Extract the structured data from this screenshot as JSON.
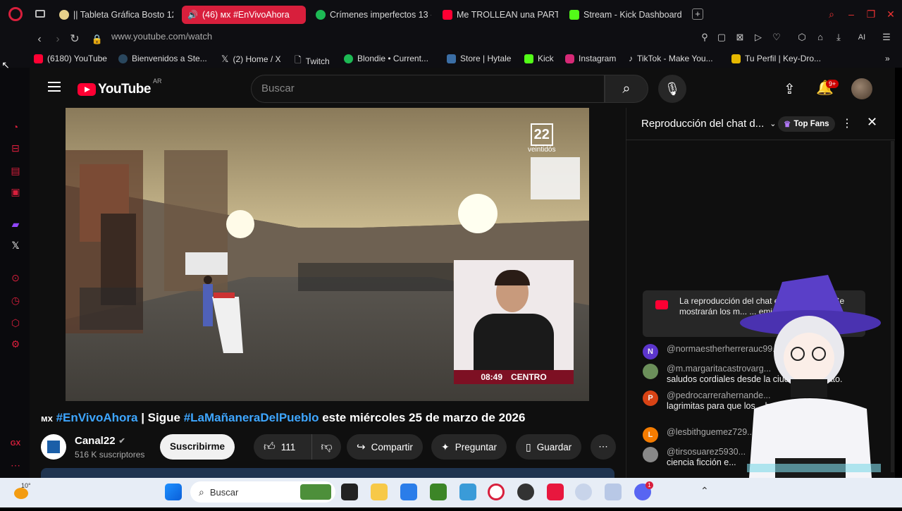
{
  "browser": {
    "tabs": [
      {
        "label": "|| Tableta Gráfica Bosto 12",
        "color": "#e6d08a"
      },
      {
        "label": "(46) мх #EnVivoAhora",
        "color": "#ffffff",
        "active": true
      },
      {
        "label": "Crímenes imperfectos 13 -",
        "color": "#1db954"
      },
      {
        "label": "Me TROLLEAN una PARTI",
        "color": "#ff0033"
      },
      {
        "label": "Stream - Kick Dashboard",
        "color": "#53fc18"
      }
    ],
    "url": "www.youtube.com/watch",
    "ai_label": "AI",
    "bookmarks": [
      {
        "label": "(6180) YouTube",
        "color": "#ff0033"
      },
      {
        "label": "Bienvenidos a Ste...",
        "color": "#1b2838"
      },
      {
        "label": "(2) Home / X",
        "color": "#000000"
      },
      {
        "label": "Twitch",
        "color": "#444444"
      },
      {
        "label": "Blondie • Current...",
        "color": "#1db954"
      },
      {
        "label": "Store | Hytale",
        "color": "#3b6ea5"
      },
      {
        "label": "Kick",
        "color": "#53fc18"
      },
      {
        "label": "Instagram",
        "color": "#d62976"
      },
      {
        "label": "TikTok - Make You...",
        "color": "#111111"
      },
      {
        "label": "Tu Perfil | Key-Dro...",
        "color": "#e6b800"
      }
    ]
  },
  "youtube": {
    "logo": "YouTube",
    "region": "AR",
    "search_placeholder": "Buscar",
    "notif_count": "9+",
    "video": {
      "watermark_number": "22",
      "watermark_label": "veintidós",
      "time": "08:49",
      "location": "CENTRO"
    },
    "title_prefix": "мх",
    "title_tag1": "#EnVivoAhora",
    "title_mid": " | Sigue ",
    "title_tag2": "#LaMañaneraDelPueblo",
    "title_rest": " este miércoles 25 de marzo de 2026",
    "channel": {
      "name": "Canal22",
      "subscribers": "516 K suscriptores",
      "subscribe_label": "Suscribirme"
    },
    "actions": {
      "likes": "111",
      "share": "Compartir",
      "ask": "Preguntar",
      "save": "Guardar"
    },
    "chat": {
      "title": "Reproducción del chat d...",
      "badge": "Top Fans",
      "notice": "La reproducción del chat en di... ...ivada. Se mostrarán los m... ... emisión en direc...",
      "messages": [
        {
          "initial": "N",
          "color": "#5c35cc",
          "name": "@normaestherherrerauc99...",
          "text": ""
        },
        {
          "initial": "",
          "color": "#6b8f5a",
          "name": "@m.margaritacastrovarg...",
          "text": "saludos cordiales desde la ciud... ...anajuato."
        },
        {
          "initial": "P",
          "color": "#d84315",
          "name": "@pedrocarrerahernande...",
          "text": "lagrimitas para que los... barbarie ....."
        },
        {
          "initial": "L",
          "color": "#f57c00",
          "name": "@lesbithguemez729...",
          "text": ""
        },
        {
          "initial": "",
          "color": "#888888",
          "name": "@tirsosuarez5930...",
          "text": "ciencia ficción e..."
        }
      ]
    }
  },
  "taskbar": {
    "weather": "10°",
    "search_label": "Buscar",
    "discord_badge": "1"
  }
}
